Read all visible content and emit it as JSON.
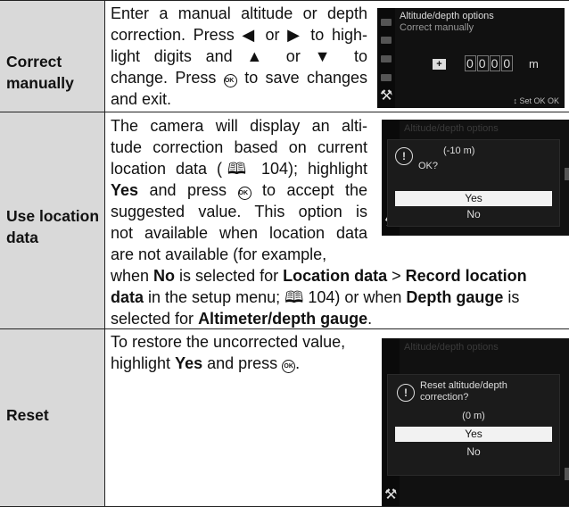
{
  "rows": [
    {
      "label_lines": [
        "Correct",
        "manually"
      ],
      "desc_lines": [
        "Enter a manual altitude or depth",
        "correction. Press ◀ or ▶ to high-",
        "light digits and ▲ or ▼ to",
        "change. Press",
        "to save changes",
        "and exit."
      ],
      "screen": {
        "title": "Altitude/depth options",
        "subtitle": "Correct manually",
        "sign": "+",
        "digits": [
          "0",
          "0",
          "0",
          "0"
        ],
        "unit": "m",
        "hint": "↕ Set OK OK"
      }
    },
    {
      "label_lines": [
        "Use location",
        "data"
      ],
      "desc_segments": [
        [
          {
            "t": "The camera will display an alti-"
          }
        ],
        [
          {
            "t": "tude correction based on current"
          }
        ],
        [
          {
            "t": "location data (🕮 104); highlight"
          }
        ],
        [
          {
            "t": "Yes",
            "b": true
          },
          {
            "t": " and press "
          },
          {
            "t": "OK",
            "icon": true
          },
          {
            "t": " to accept the"
          }
        ],
        [
          {
            "t": "suggested value. This option is"
          }
        ],
        [
          {
            "t": "not available when location data"
          }
        ],
        [
          {
            "t": "are not available (for example,"
          }
        ]
      ],
      "cont_segments": [
        [
          {
            "t": "when "
          },
          {
            "t": "No",
            "b": true
          },
          {
            "t": " is selected for "
          },
          {
            "t": "Location data",
            "b": true
          },
          {
            "t": " > "
          },
          {
            "t": "Record location",
            "b": true
          }
        ],
        [
          {
            "t": "data",
            "b": true
          },
          {
            "t": " in the setup menu; 🕮 104) or when "
          },
          {
            "t": "Depth gauge",
            "b": true
          },
          {
            "t": " is"
          }
        ],
        [
          {
            "t": "selected for "
          },
          {
            "t": "Altimeter/depth gauge",
            "b": true
          },
          {
            "t": "."
          }
        ]
      ],
      "screen": {
        "title": "Altitude/depth options",
        "value": "(-10 m)",
        "question": "OK?",
        "options": [
          "Yes",
          "No"
        ]
      }
    },
    {
      "label_lines": [
        "Reset"
      ],
      "desc_segments": [
        [
          {
            "t": "To restore the uncorrected value,"
          }
        ],
        [
          {
            "t": "highlight "
          },
          {
            "t": "Yes",
            "b": true
          },
          {
            "t": " and press "
          },
          {
            "t": "OK",
            "icon": true
          },
          {
            "t": "."
          }
        ]
      ],
      "screen": {
        "title": "Altitude/depth options",
        "message": [
          "Reset altitude/depth",
          "correction?"
        ],
        "value": "(0 m)",
        "options": [
          "Yes",
          "No"
        ]
      }
    }
  ]
}
